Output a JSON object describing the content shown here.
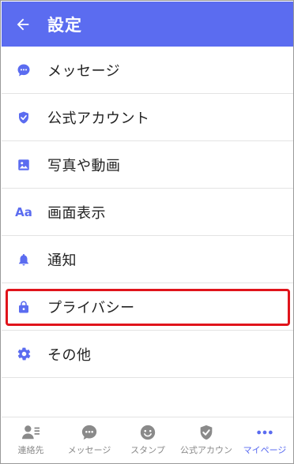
{
  "header": {
    "title": "設定",
    "back_icon": "arrow-left-icon"
  },
  "accent": "#5b6cf0",
  "highlight_color": "#e0141b",
  "settings": [
    {
      "label": "メッセージ",
      "icon": "chat-bubble-icon"
    },
    {
      "label": "公式アカウント",
      "icon": "shield-check-icon"
    },
    {
      "label": "写真や動画",
      "icon": "image-icon"
    },
    {
      "label": "画面表示",
      "icon": "font-aa-icon",
      "icon_text": "Aa"
    },
    {
      "label": "通知",
      "icon": "bell-icon"
    },
    {
      "label": "プライバシー",
      "icon": "lock-icon",
      "highlighted": true
    },
    {
      "label": "その他",
      "icon": "gear-icon"
    }
  ],
  "tabs": [
    {
      "label": "連絡先",
      "icon": "contacts-icon"
    },
    {
      "label": "メッセージ",
      "icon": "chat-bubble-icon"
    },
    {
      "label": "スタンプ",
      "icon": "smiley-icon"
    },
    {
      "label": "公式アカウン",
      "icon": "shield-check-icon"
    },
    {
      "label": "マイページ",
      "icon": "more-dots-icon",
      "active": true
    }
  ]
}
